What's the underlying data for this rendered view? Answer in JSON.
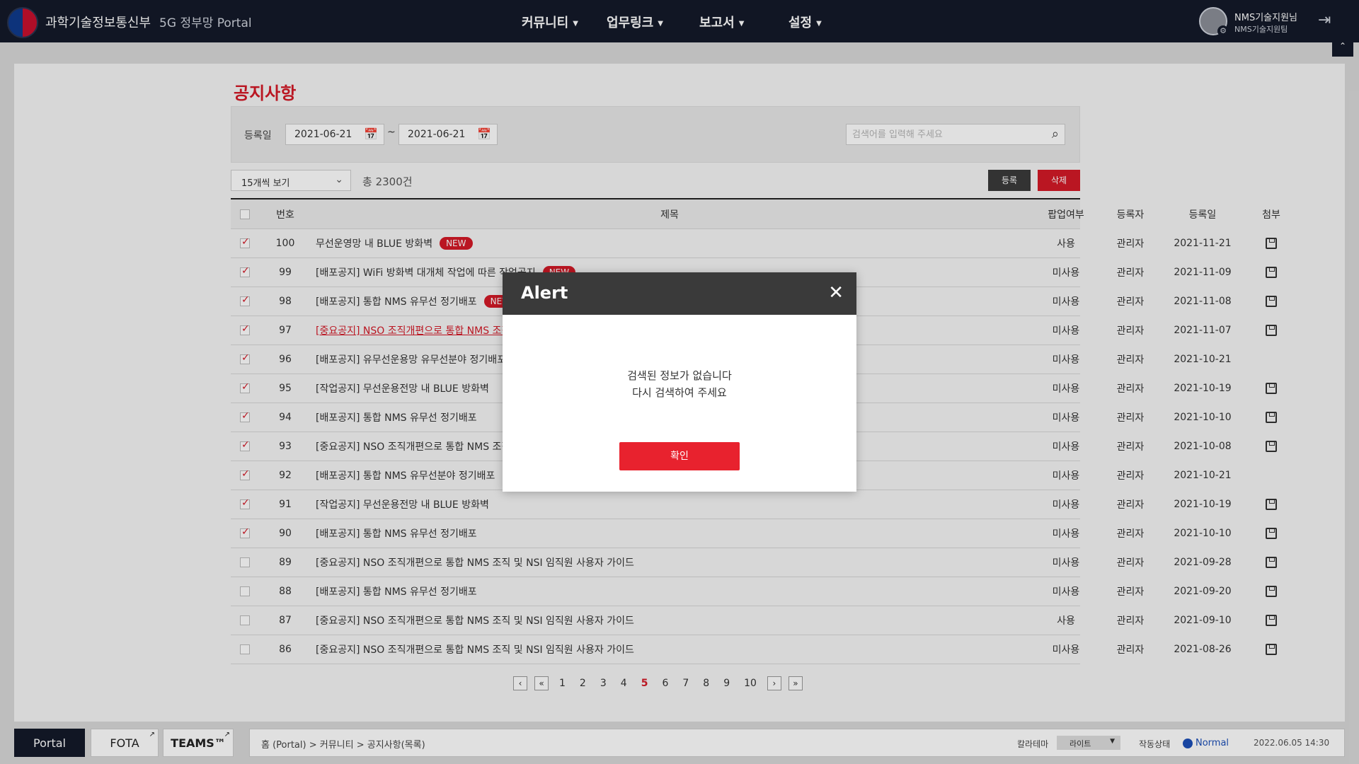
{
  "header": {
    "brand": "과학기술정보통신부",
    "portal": "5G 정부망 Portal",
    "nav": [
      "커뮤니티",
      "업무링크",
      "보고서",
      "설정"
    ],
    "user_name": "NMS기술지원님",
    "user_team": "NMS기술지원팀"
  },
  "page": {
    "title": "공지사항",
    "filter_label": "등록일",
    "date_from": "2021-06-21",
    "date_to": "2021-06-21",
    "tilde": "~",
    "search_placeholder": "검색어를 입력해 주세요",
    "page_size": "15개씩 보기",
    "total": "총 2300건",
    "register_label": "등록",
    "delete_label": "삭제"
  },
  "table": {
    "headers": [
      "번호",
      "제목",
      "팝업여부",
      "등록자",
      "등록일",
      "첨부"
    ],
    "rows": [
      {
        "checked": true,
        "num": "100",
        "title": "무선운영망 내 BLUE 방화벽",
        "new": true,
        "link": false,
        "popup": "사용",
        "user": "관리자",
        "date": "2021-11-21",
        "attach": true
      },
      {
        "checked": true,
        "num": "99",
        "title": "[배포공지] WiFi 방화벽 대개체 작업에 따른 작업공지",
        "new": true,
        "link": false,
        "popup": "미사용",
        "user": "관리자",
        "date": "2021-11-09",
        "attach": true
      },
      {
        "checked": true,
        "num": "98",
        "title": "[배포공지] 통합 NMS 유무선 정기배포",
        "new": true,
        "link": false,
        "popup": "미사용",
        "user": "관리자",
        "date": "2021-11-08",
        "attach": true
      },
      {
        "checked": true,
        "num": "97",
        "title": "[중요공지] NSO 조직개편으로 통합 NMS 조직",
        "new": false,
        "link": true,
        "popup": "미사용",
        "user": "관리자",
        "date": "2021-11-07",
        "attach": true
      },
      {
        "checked": true,
        "num": "96",
        "title": "[배포공지] 유무선운용망 유무선분야 정기배포",
        "new": false,
        "link": false,
        "popup": "미사용",
        "user": "관리자",
        "date": "2021-10-21",
        "attach": false
      },
      {
        "checked": true,
        "num": "95",
        "title": "[작업공지] 무선운용전망 내  BLUE 방화벽",
        "new": false,
        "link": false,
        "popup": "미사용",
        "user": "관리자",
        "date": "2021-10-19",
        "attach": true
      },
      {
        "checked": true,
        "num": "94",
        "title": "[배포공지] 통합 NMS 유무선 정기배포",
        "new": false,
        "link": false,
        "popup": "미사용",
        "user": "관리자",
        "date": "2021-10-10",
        "attach": true
      },
      {
        "checked": true,
        "num": "93",
        "title": "[중요공지] NSO 조직개편으로 통합 NMS 조직",
        "new": false,
        "link": false,
        "popup": "미사용",
        "user": "관리자",
        "date": "2021-10-08",
        "attach": true
      },
      {
        "checked": true,
        "num": "92",
        "title": "[배포공지] 통합 NMS 유무선분야 정기배포",
        "new": false,
        "link": false,
        "popup": "미사용",
        "user": "관리자",
        "date": "2021-10-21",
        "attach": false
      },
      {
        "checked": true,
        "num": "91",
        "title": "[작업공지] 무선운용전망 내  BLUE 방화벽",
        "new": false,
        "link": false,
        "popup": "미사용",
        "user": "관리자",
        "date": "2021-10-19",
        "attach": true
      },
      {
        "checked": true,
        "num": "90",
        "title": "[배포공지] 통합 NMS 유무선 정기배포",
        "new": false,
        "link": false,
        "popup": "미사용",
        "user": "관리자",
        "date": "2021-10-10",
        "attach": true
      },
      {
        "checked": false,
        "num": "89",
        "title": "[중요공지] NSO 조직개편으로 통합 NMS 조직 및 NSI 임직원 사용자 가이드",
        "new": false,
        "link": false,
        "popup": "미사용",
        "user": "관리자",
        "date": "2021-09-28",
        "attach": true
      },
      {
        "checked": false,
        "num": "88",
        "title": "[배포공지] 통합 NMS 유무선 정기배포",
        "new": false,
        "link": false,
        "popup": "미사용",
        "user": "관리자",
        "date": "2021-09-20",
        "attach": true
      },
      {
        "checked": false,
        "num": "87",
        "title": "[중요공지] NSO 조직개편으로 통합 NMS 조직 및 NSI 임직원 사용자 가이드",
        "new": false,
        "link": false,
        "popup": "사용",
        "user": "관리자",
        "date": "2021-09-10",
        "attach": true
      },
      {
        "checked": false,
        "num": "86",
        "title": "[중요공지] NSO 조직개편으로 통합 NMS 조직 및 NSI 임직원 사용자 가이드",
        "new": false,
        "link": false,
        "popup": "미사용",
        "user": "관리자",
        "date": "2021-08-26",
        "attach": true
      }
    ],
    "new_label": "NEW"
  },
  "pagination": {
    "pages": [
      "1",
      "2",
      "3",
      "4",
      "5",
      "6",
      "7",
      "8",
      "9",
      "10"
    ],
    "current": "5"
  },
  "bottom": {
    "tabs": [
      "Portal",
      "FOTA",
      "TEAMS™"
    ],
    "breadcrumb": "홈 (Portal)  > 커뮤니티 > 공지사항(목록)",
    "theme_label": "칼라테마",
    "theme_value": "라이트",
    "status_label": "작동상태",
    "status_value": "Normal",
    "datetime": "2022.06.05 14:30"
  },
  "modal": {
    "title": "Alert",
    "line1": "검색된 정보가 없습니다",
    "line2": "다시 검색하여 주세요",
    "ok_label": "확인"
  },
  "colors": {
    "accent": "#d41a27",
    "topbar": "#141a2a",
    "status": "#1c4fb8"
  }
}
